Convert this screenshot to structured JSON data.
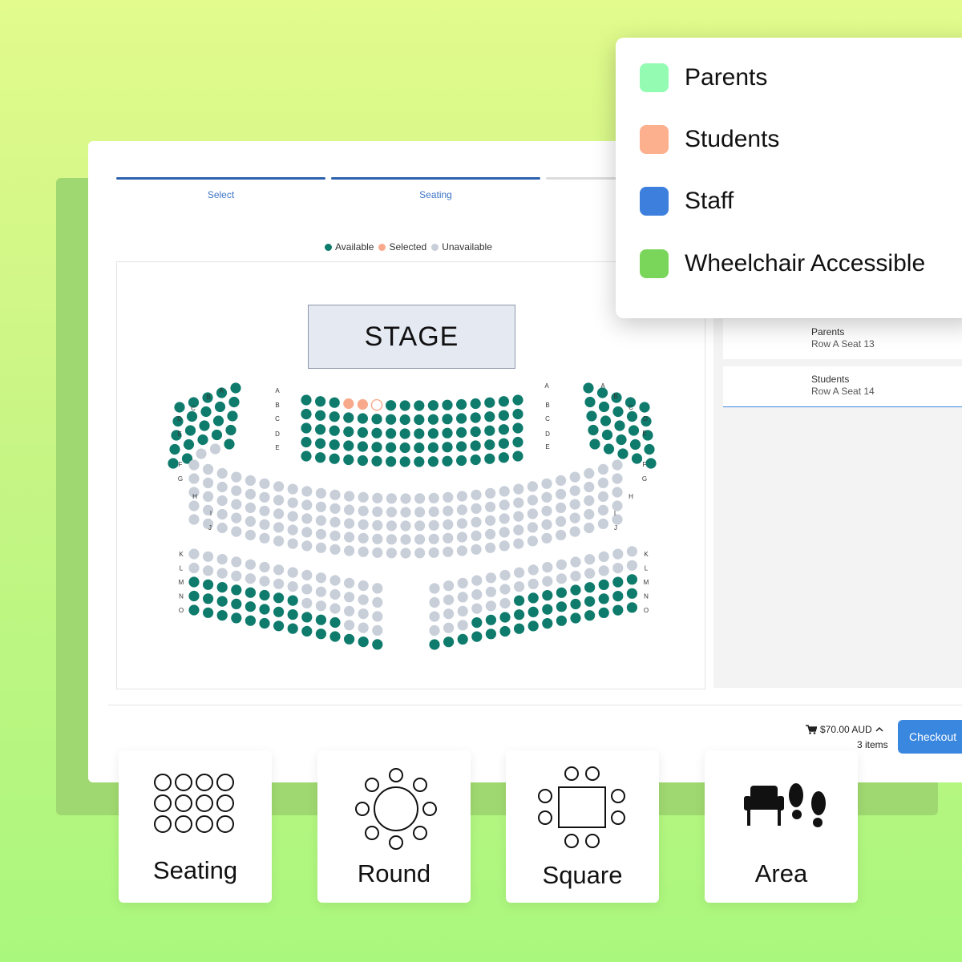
{
  "steps": [
    {
      "label": "Select",
      "state": "complete"
    },
    {
      "label": "Seating",
      "state": "active"
    },
    {
      "label": "",
      "state": "upcoming"
    }
  ],
  "seat_legend": {
    "available": "Available",
    "selected": "Selected",
    "unavailable": "Unavailable"
  },
  "colors": {
    "available": "#0e7b6c",
    "selected": "#f9a98b",
    "unavailable": "#c8cfd9",
    "accent": "#3a87e0"
  },
  "stage_label": "STAGE",
  "row_labels": {
    "front_left": [
      "A",
      "B",
      "C",
      "D",
      "E"
    ],
    "front_right": [
      "A",
      "B",
      "C",
      "D",
      "E"
    ],
    "middle_left": [
      "F",
      "G",
      "H",
      "I",
      "J"
    ],
    "middle_right": [
      "F",
      "G",
      "H",
      "I",
      "J"
    ],
    "rear_left": [
      "K",
      "L",
      "M",
      "N",
      "O"
    ],
    "rear_right": [
      "K",
      "L",
      "M",
      "N",
      "O"
    ]
  },
  "tickets": [
    {
      "group": "Parents",
      "seat": "Row A Seat 13"
    },
    {
      "group": "Students",
      "seat": "Row A Seat 14"
    }
  ],
  "cart": {
    "total": "$70.00 AUD",
    "items": "3 items",
    "checkout_label": "Checkout"
  },
  "category_legend": [
    {
      "label": "Parents",
      "color": "#94fbb3"
    },
    {
      "label": "Students",
      "color": "#fdb08e"
    },
    {
      "label": "Staff",
      "color": "#3c7fdc"
    },
    {
      "label": "Wheelchair Accessible",
      "color": "#7ad65b"
    }
  ],
  "tools": [
    {
      "label": "Seating",
      "icon": "seating-grid-icon"
    },
    {
      "label": "Round",
      "icon": "round-table-icon"
    },
    {
      "label": "Square",
      "icon": "square-table-icon"
    },
    {
      "label": "Area",
      "icon": "armchair-footprints-icon"
    }
  ]
}
